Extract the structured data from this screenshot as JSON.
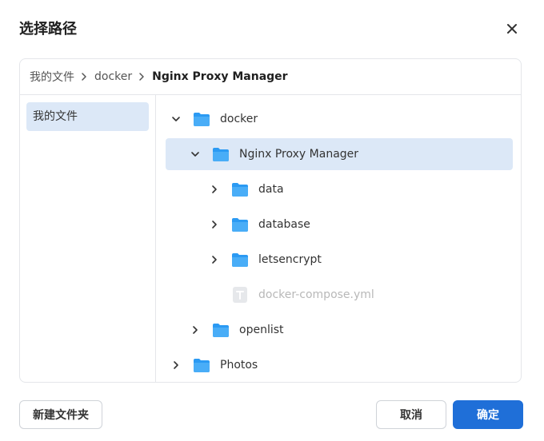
{
  "dialog": {
    "title": "选择路径"
  },
  "breadcrumb": [
    "我的文件",
    "docker",
    "Nginx Proxy Manager"
  ],
  "sidebar": {
    "items": [
      {
        "label": "我的文件",
        "selected": true
      }
    ]
  },
  "tree": [
    {
      "label": "docker",
      "type": "folder",
      "expanded": true
    },
    {
      "label": "Nginx Proxy Manager",
      "type": "folder",
      "expanded": true,
      "selected": true
    },
    {
      "label": "data",
      "type": "folder",
      "expanded": false
    },
    {
      "label": "database",
      "type": "folder",
      "expanded": false
    },
    {
      "label": "letsencrypt",
      "type": "folder",
      "expanded": false
    },
    {
      "label": "docker-compose.yml",
      "type": "file",
      "disabled": true
    },
    {
      "label": "openlist",
      "type": "folder",
      "expanded": false
    },
    {
      "label": "Photos",
      "type": "folder",
      "expanded": false
    }
  ],
  "buttons": {
    "new_folder": "新建文件夹",
    "cancel": "取消",
    "confirm": "确定"
  },
  "colors": {
    "accent": "#1f6fd8",
    "selection": "#dce8f7",
    "folder": "#2b9af3"
  }
}
